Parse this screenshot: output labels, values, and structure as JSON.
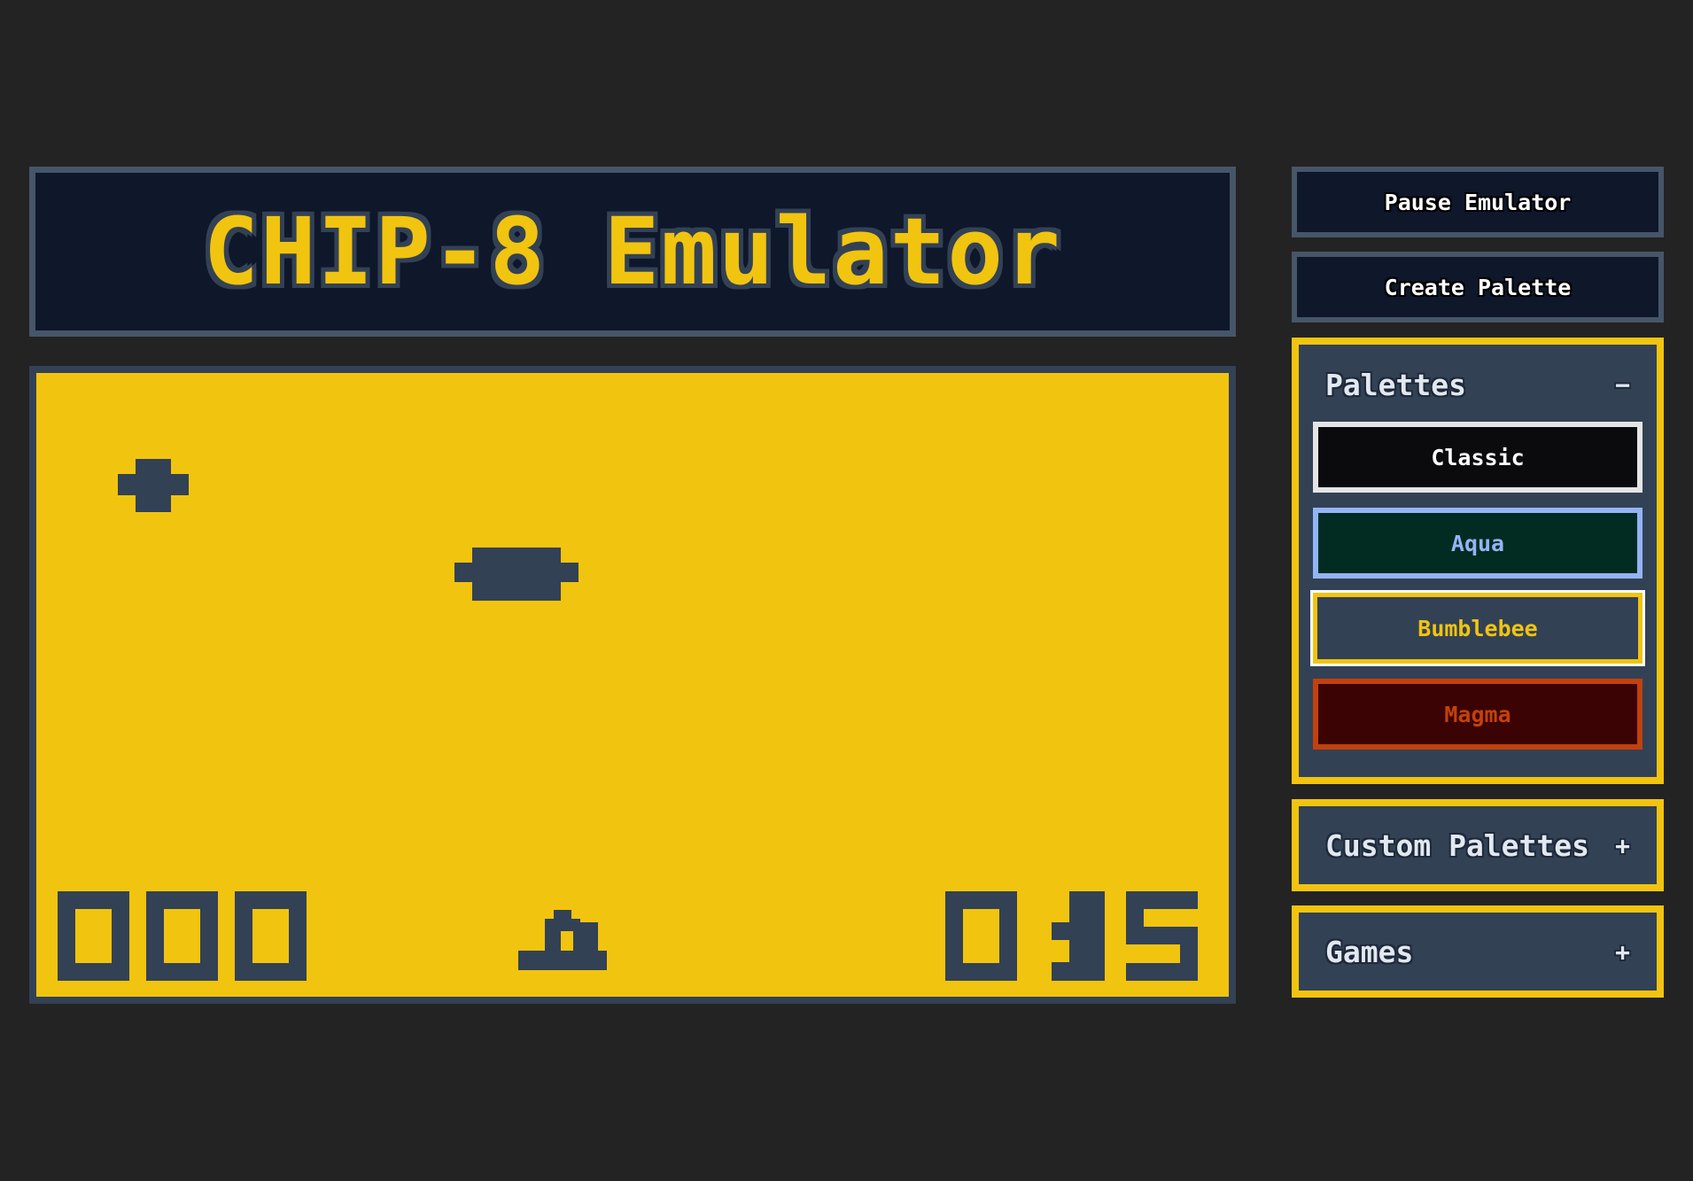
{
  "app": {
    "title": "CHIP-8 Emulator"
  },
  "colors": {
    "background": "#232323",
    "accent": "#f1c40f",
    "screen_bg": "#f1c40f",
    "screen_fg": "#334155",
    "panel_bg": "#334155",
    "title_bg": "#0f172a"
  },
  "controls": {
    "pause_label": "Pause Emulator",
    "create_palette_label": "Create Palette"
  },
  "palettes_panel": {
    "title": "Palettes",
    "toggle": "−",
    "items": [
      {
        "label": "Classic",
        "bg": "#0b0b0d",
        "fg": "#ffffff",
        "border": "#e5e5e5"
      },
      {
        "label": "Aqua",
        "bg": "#022c22",
        "fg": "#93b4f5",
        "border": "#93b4f5"
      },
      {
        "label": "Bumblebee",
        "bg": "#334155",
        "fg": "#f1c40f",
        "border": "#f1c40f",
        "selected": true
      },
      {
        "label": "Magma",
        "bg": "#3b0303",
        "fg": "#c2410c",
        "border": "#c2410c"
      }
    ]
  },
  "custom_palettes_panel": {
    "title": "Custom Palettes",
    "toggle": "+"
  },
  "games_panel": {
    "title": "Games",
    "toggle": "+"
  },
  "game_screen": {
    "score_left": "000",
    "score_right": "015"
  }
}
